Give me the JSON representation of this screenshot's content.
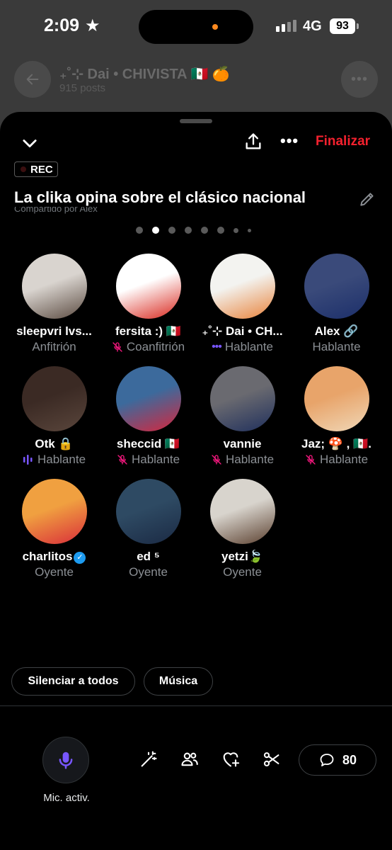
{
  "status_bar": {
    "time": "2:09",
    "network": "4G",
    "battery": "93"
  },
  "profile": {
    "name": "₊˚⊹ Dai • CHIVISTA 🇲🇽 🍊",
    "posts": "915 posts"
  },
  "space": {
    "finalize_label": "Finalizar",
    "rec_label": "REC",
    "title": "La clika opina sobre el clásico nacional",
    "shared_by": "Compartido por Alex",
    "page_count": 8,
    "active_page": 2
  },
  "participants": [
    {
      "name": "sleepvri lvs...",
      "role": "Anfitrión",
      "status": "none",
      "colors": [
        "#d9d4cf",
        "#5a4a40"
      ]
    },
    {
      "name": "fersita :) 🇲🇽",
      "role": "Coanfitrión",
      "status": "muted",
      "colors": [
        "#ffffff",
        "#d9261c"
      ]
    },
    {
      "name": "₊˚⊹ Dai • CH...",
      "role": "Hablante",
      "status": "speaking-dots",
      "colors": [
        "#f3f3f0",
        "#e8823a"
      ]
    },
    {
      "name": "Alex 🔗",
      "role": "Hablante",
      "status": "none",
      "colors": [
        "#3a4a7a",
        "#1c2f6a"
      ]
    },
    {
      "name": "Otk 🔒",
      "role": "Hablante",
      "status": "speaking-bars",
      "colors": [
        "#3b2a24",
        "#5a463c"
      ]
    },
    {
      "name": "sheccid 🇲🇽",
      "role": "Hablante",
      "status": "muted",
      "colors": [
        "#3c6a9c",
        "#d7263d"
      ]
    },
    {
      "name": "vannie",
      "role": "Hablante",
      "status": "muted",
      "colors": [
        "#6a6a70",
        "#1f2f5c"
      ]
    },
    {
      "name": "Jaz; 🍄 , 🇲🇽.",
      "role": "Hablante",
      "status": "muted",
      "colors": [
        "#e8a46a",
        "#f0d8b8"
      ]
    },
    {
      "name": "charlitos",
      "role": "Oyente",
      "status": "none",
      "verified": true,
      "colors": [
        "#f0a040",
        "#d92d3a"
      ]
    },
    {
      "name": "ed ⁵",
      "role": "Oyente",
      "status": "none",
      "colors": [
        "#2e4a63",
        "#1b2a44"
      ]
    },
    {
      "name": "yetzi🍃",
      "role": "Oyente",
      "status": "none",
      "colors": [
        "#d8d4cd",
        "#5a3f2e"
      ]
    }
  ],
  "actions": {
    "mute_all": "Silenciar a todos",
    "music": "Música"
  },
  "bottom": {
    "mic_label": "Mic. activ.",
    "comment_count": "80"
  },
  "colors": {
    "accent": "#7856ff",
    "finalize": "#f4212e",
    "mute": "#f91880"
  },
  "icons": [
    "chevron-down-icon",
    "share-icon",
    "more-icon",
    "edit-icon",
    "mic-icon",
    "magic-wand-icon",
    "people-icon",
    "heart-plus-icon",
    "scissors-icon",
    "comment-icon"
  ]
}
